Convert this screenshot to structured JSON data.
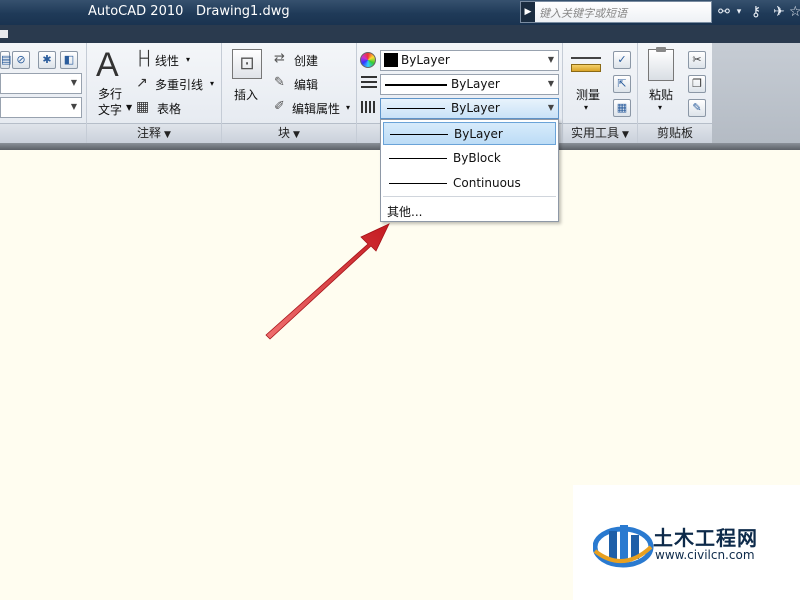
{
  "titlebar": {
    "app_title": "AutoCAD 2010",
    "doc_title": "Drawing1.dwg",
    "search_placeholder": "键入关键字或短语"
  },
  "ribbon": {
    "annotation": {
      "mtext_glyph": "A",
      "mtext_label_line1": "多行",
      "mtext_label_line2": "文字",
      "linear_label": "线性",
      "multileader_label": "多重引线",
      "table_label": "表格",
      "panel_title": "注释"
    },
    "block": {
      "insert_label": "插入",
      "create_label": "创建",
      "edit_label": "编辑",
      "edit_attr_label": "编辑属性",
      "panel_title": "块"
    },
    "properties": {
      "color_value": "ByLayer",
      "lineweight_value": "ByLayer",
      "linetype_value": "ByLayer"
    },
    "utilities": {
      "measure_label": "测量",
      "panel_title": "实用工具"
    },
    "clipboard": {
      "paste_label": "粘贴",
      "panel_title": "剪贴板"
    }
  },
  "linetype_dropdown": {
    "items": [
      {
        "label": "ByLayer",
        "selected": true
      },
      {
        "label": "ByBlock",
        "selected": false
      },
      {
        "label": "Continuous",
        "selected": false
      }
    ],
    "other_label": "其他..."
  },
  "watermark": {
    "name": "土木工程网",
    "url": "www.civilcn.com"
  },
  "colors": {
    "arrow": "#d0242a",
    "canvas": "#fffdf0",
    "titlebar": "#1f3a58",
    "selection": "#bcdcf6"
  }
}
